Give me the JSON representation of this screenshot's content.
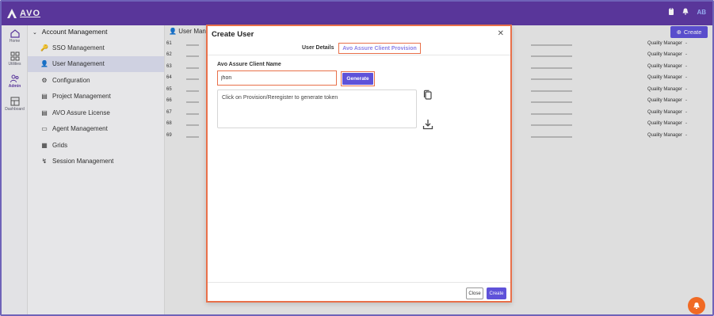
{
  "app": {
    "logo_text": "AVO"
  },
  "header": {
    "icons": [
      "clipboard-icon",
      "bell-icon"
    ],
    "avatar_initials": "AB"
  },
  "rail": [
    {
      "label": "Home",
      "icon": "home-icon"
    },
    {
      "label": "Utilities",
      "icon": "grid-icon"
    },
    {
      "label": "Admin",
      "icon": "users-icon"
    },
    {
      "label": "Dashboard",
      "icon": "dashboard-icon"
    }
  ],
  "menu": {
    "section": "Account Management",
    "items": [
      {
        "label": "SSO Management",
        "icon": "key-icon"
      },
      {
        "label": "User Management",
        "icon": "user-icon"
      },
      {
        "label": "Configuration",
        "icon": "gear-icon"
      },
      {
        "label": "Project Management",
        "icon": "folder-icon"
      },
      {
        "label": "AVO Assure License",
        "icon": "license-icon"
      },
      {
        "label": "Agent Management",
        "icon": "monitor-icon"
      },
      {
        "label": "Grids",
        "icon": "grid-icon"
      },
      {
        "label": "Session Management",
        "icon": "session-icon"
      }
    ]
  },
  "table": {
    "title": "User Mana",
    "create_label": "Create",
    "rows": [
      {
        "num": "61",
        "role": "Quality Manager"
      },
      {
        "num": "62",
        "role": "Quality Manager"
      },
      {
        "num": "63",
        "role": "Quality Manager"
      },
      {
        "num": "64",
        "role": "Quality Manager"
      },
      {
        "num": "65",
        "role": "Quality Manager"
      },
      {
        "num": "66",
        "role": "Quality Manager"
      },
      {
        "num": "67",
        "role": "Quality Manager"
      },
      {
        "num": "68",
        "role": "Quality Manager"
      },
      {
        "num": "69",
        "role": "Quality Manager"
      }
    ]
  },
  "modal": {
    "title": "Create User",
    "tabs": [
      "User Details",
      "Avo Assure Client Provision"
    ],
    "field_label": "Avo Assure Client Name",
    "client_name_value": "jhon",
    "generate_label": "Generate",
    "token_placeholder": "Click on Provision/Reregister to generate token",
    "close_label": "Close",
    "create_label": "Create"
  },
  "colors": {
    "brand": "#5f3aa4",
    "accent": "#5f52d9",
    "highlight": "#e8704a",
    "fab": "#f06a24"
  }
}
